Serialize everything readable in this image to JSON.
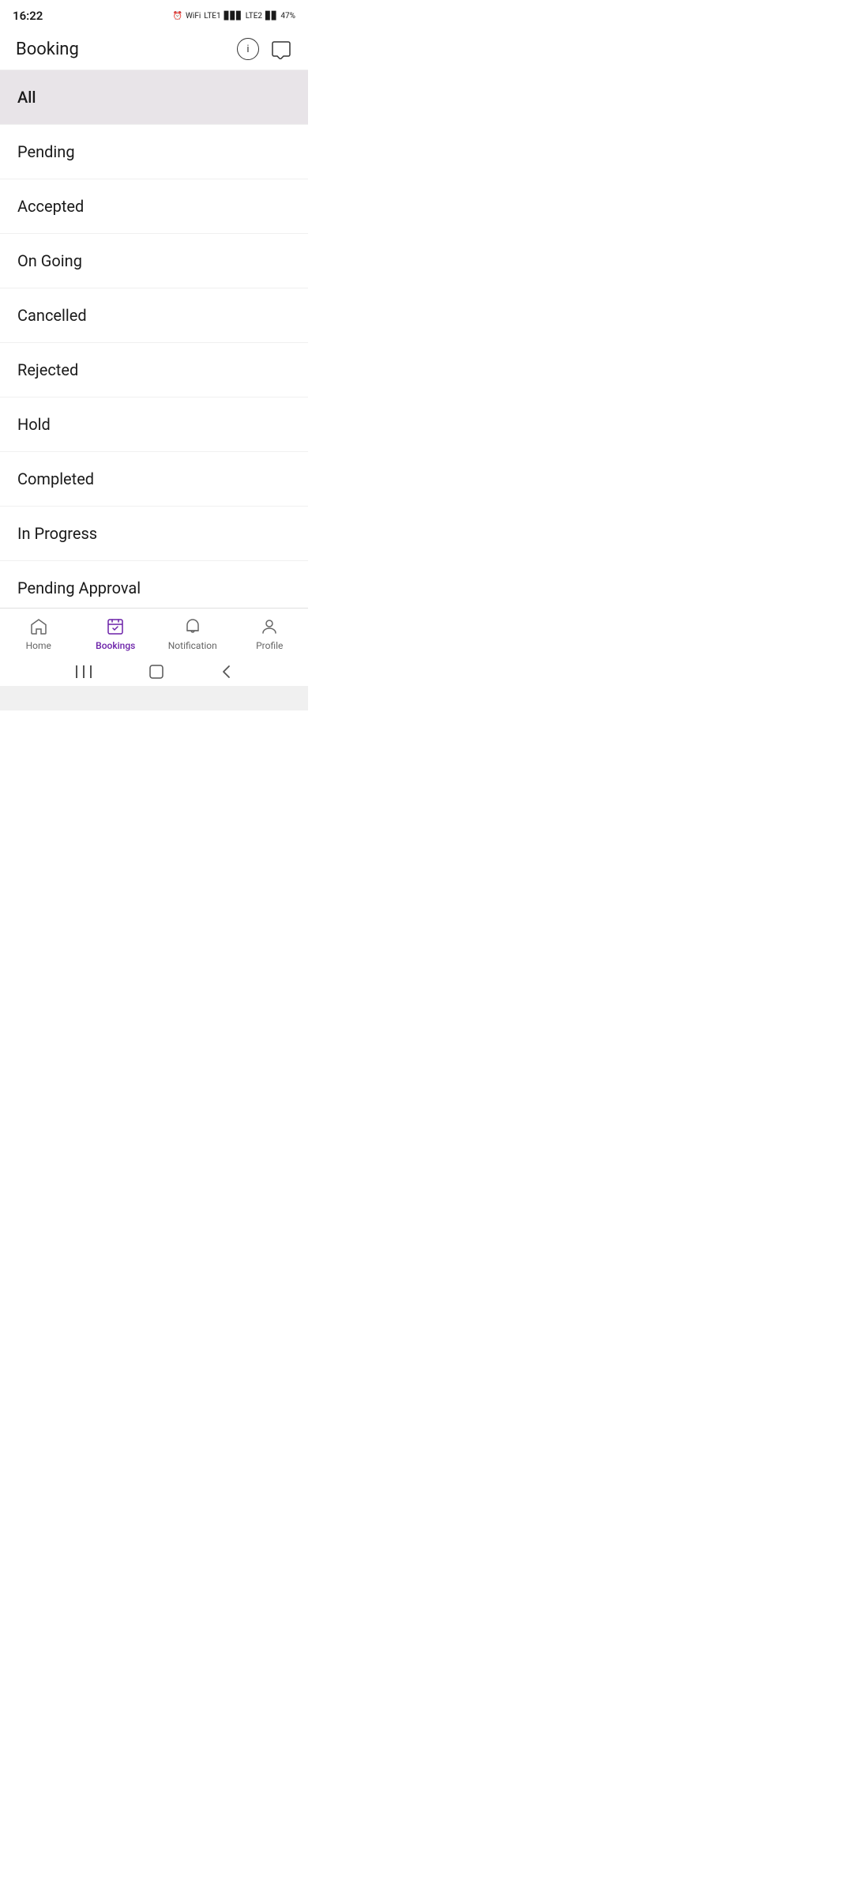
{
  "status_bar": {
    "time": "16:22",
    "battery": "47%"
  },
  "app_bar": {
    "title": "Booking",
    "info_icon": "ℹ",
    "chat_icon": "💬"
  },
  "filter_items": [
    {
      "id": "all",
      "label": "All",
      "active": true
    },
    {
      "id": "pending",
      "label": "Pending",
      "active": false
    },
    {
      "id": "accepted",
      "label": "Accepted",
      "active": false
    },
    {
      "id": "ongoing",
      "label": "On Going",
      "active": false
    },
    {
      "id": "cancelled",
      "label": "Cancelled",
      "active": false
    },
    {
      "id": "rejected",
      "label": "Rejected",
      "active": false
    },
    {
      "id": "hold",
      "label": "Hold",
      "active": false
    },
    {
      "id": "completed",
      "label": "Completed",
      "active": false
    },
    {
      "id": "inprogress",
      "label": "In Progress",
      "active": false
    },
    {
      "id": "pendingapproval",
      "label": "Pending Approval",
      "active": false
    }
  ],
  "bottom_nav": {
    "items": [
      {
        "id": "home",
        "label": "Home",
        "active": false
      },
      {
        "id": "bookings",
        "label": "Bookings",
        "active": true
      },
      {
        "id": "notification",
        "label": "Notification",
        "active": false
      },
      {
        "id": "profile",
        "label": "Profile",
        "active": false
      }
    ]
  },
  "android_nav": {
    "back": "<",
    "home": "○",
    "recent": "|||"
  }
}
